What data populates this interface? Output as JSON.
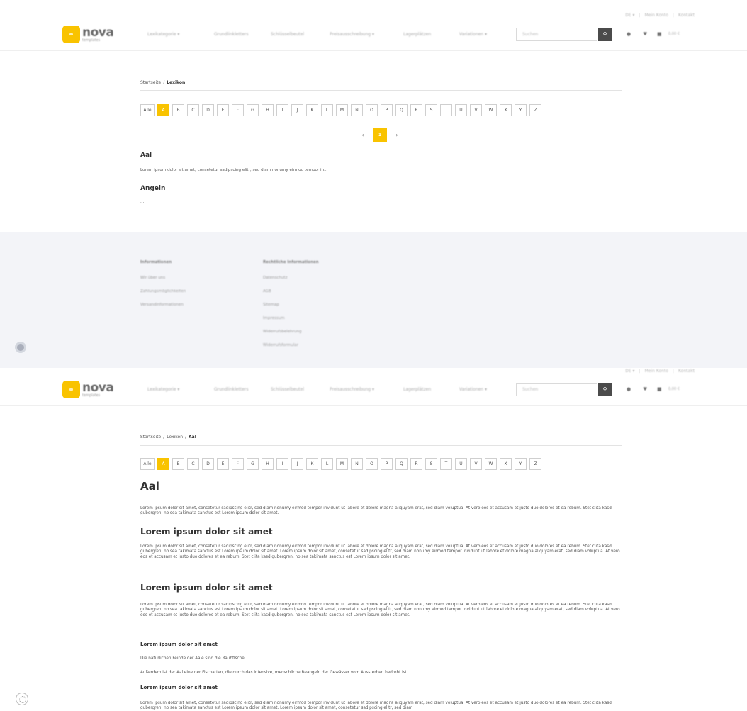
{
  "header": {
    "topbar": [
      "DE ▾",
      "Mein Konto",
      "Kontakt"
    ],
    "logo": {
      "name": "nova",
      "sub": "templates"
    },
    "nav": [
      "Lexikategorie ▾",
      "Grundlinkletters",
      "Schlüsselbeutel",
      "Preisausschreibung ▾",
      "Lagerplätzen",
      "Variationen ▾"
    ],
    "search_placeholder": "Suchen",
    "search_icon": "magnifier-icon",
    "icons": [
      "user-icon",
      "heart-icon",
      "cart-icon"
    ],
    "cart_value": "0,00 €"
  },
  "screen1": {
    "breadcrumb": {
      "home": "Startseite",
      "current": "Lexikon"
    },
    "alphabet": {
      "all_label": "Alle",
      "letters": [
        "A",
        "B",
        "C",
        "D",
        "E",
        "F",
        "G",
        "H",
        "I",
        "J",
        "K",
        "L",
        "M",
        "N",
        "O",
        "P",
        "Q",
        "R",
        "S",
        "T",
        "U",
        "V",
        "W",
        "X",
        "Y",
        "Z"
      ],
      "active": "A"
    },
    "pagination": {
      "prev": "‹",
      "current": "1",
      "next": "›"
    },
    "entries": [
      {
        "title": "Aal",
        "text": "Lorem ipsum dolor sit amet, consetetur sadipscing elitr, sed diam nonumy eirmod tempor in..."
      },
      {
        "title": "Angeln",
        "text": "..."
      }
    ]
  },
  "footer": {
    "col1": {
      "heading": "Informationen",
      "items": [
        "Wir über uns",
        "Zahlungsmöglichkeiten",
        "Versandinformationen"
      ]
    },
    "col2": {
      "heading": "Rechtliche Informationen",
      "items": [
        "Datenschutz",
        "AGB",
        "Sitemap",
        "Impressum",
        "Widerrufsbelehrung",
        "Widerrufsformular"
      ]
    }
  },
  "screen2": {
    "breadcrumb": {
      "home": "Startseite",
      "mid": "Lexikon",
      "current": "Aal"
    },
    "title": "Aal",
    "intro": "Lorem ipsum dolor sit amet, consetetur sadipscing elitr, sed diam nonumy eirmod tempor invidunt ut labore et dolore magna aliquyam erat, sed diam voluptua. At vero eos et accusam et justo duo dolores et ea rebum. Stet clita kasd gubergren, no sea takimata sanctus est Lorem ipsum dolor sit amet.",
    "section1": {
      "heading": "Lorem ipsum dolor sit amet",
      "text": "Lorem ipsum dolor sit amet, consetetur sadipscing elitr, sed diam nonumy eirmod tempor invidunt ut labore et dolore magna aliquyam erat, sed diam voluptua. At vero eos et accusam et justo duo dolores et ea rebum. Stet clita kasd gubergren, no sea takimata sanctus est Lorem ipsum dolor sit amet. Lorem ipsum dolor sit amet, consetetur sadipscing elitr, sed diam nonumy eirmod tempor invidunt ut labore et dolore magna aliquyam erat, sed diam voluptua. At vero eos et accusam et justo duo dolores et ea rebum. Stet clita kasd gubergren, no sea takimata sanctus est Lorem ipsum dolor sit amet."
    },
    "section2": {
      "heading": "Lorem ipsum dolor sit amet",
      "text": "Lorem ipsum dolor sit amet, consetetur sadipscing elitr, sed diam nonumy eirmod tempor invidunt ut labore et dolore magna aliquyam erat, sed diam voluptua. At vero eos et accusam et justo duo dolores et ea rebum. Stet clita kasd gubergren, no sea takimata sanctus est Lorem ipsum dolor sit amet. Lorem ipsum dolor sit amet, consetetur sadipscing elitr, sed diam nonumy eirmod tempor invidunt ut labore et dolore magna aliquyam erat, sed diam voluptua. At vero eos et accusam et justo duo dolores et ea rebum. Stet clita kasd gubergren, no sea takimata sanctus est Lorem ipsum dolor sit amet."
    },
    "section3": {
      "heading": "Lorem ipsum dolor sit amet",
      "line1": "Die natürlichen Feinde der Aale sind die Raubfische.",
      "line2": "Außerdem ist der Aal eine der Fischarten, die durch das intensive, menschliche Beangeln der Gewässer vom Aussterben bedroht ist."
    },
    "section4": {
      "heading": "Lorem ipsum dolor sit amet",
      "text": "Lorem ipsum dolor sit amet, consetetur sadipscing elitr, sed diam nonumy eirmod tempor invidunt ut labore et dolore magna aliquyam erat, sed diam voluptua. At vero eos et accusam et justo duo dolores et ea rebum. Stet clita kasd gubergren, no sea takimata sanctus est Lorem ipsum dolor sit amet. Lorem ipsum dolor sit amet, consetetur sadipscing elitr, sed diam"
    }
  },
  "colors": {
    "accent": "#f9c300",
    "footer_bg": "#f3f4f8",
    "search_btn": "#4b4b4b"
  }
}
